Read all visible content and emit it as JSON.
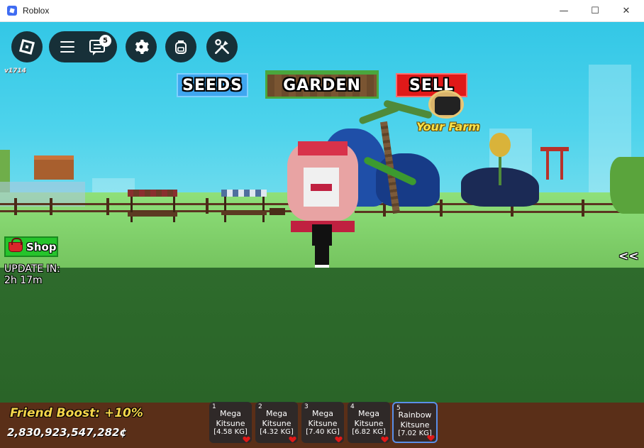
{
  "window": {
    "title": "Roblox",
    "minimize": "—",
    "maximize": "☐",
    "close": "✕"
  },
  "hud": {
    "chat_badge": "5",
    "version": "v1714"
  },
  "game_buttons": {
    "seeds": "SEEDS",
    "garden": "GARDEN",
    "sell": "SELL"
  },
  "farm": {
    "label": "Your Farm"
  },
  "shop": {
    "label": "Shop"
  },
  "update": {
    "label": "UPDATE IN:",
    "time": "2h 17m"
  },
  "side_toggle": "<<",
  "bottom": {
    "friend_boost": "Friend Boost: +10%",
    "money": "2,830,923,547,282¢"
  },
  "hotbar": [
    {
      "num": "1",
      "name": "Mega\nKitsune",
      "weight": "[4.58 KG]",
      "selected": false
    },
    {
      "num": "2",
      "name": "Mega\nKitsune",
      "weight": "[4.32 KG]",
      "selected": false
    },
    {
      "num": "3",
      "name": "Mega\nKitsune",
      "weight": "[7.40 KG]",
      "selected": false
    },
    {
      "num": "4",
      "name": "Mega\nKitsune",
      "weight": "[6.82 KG]",
      "selected": false
    },
    {
      "num": "5",
      "name": "Rainbow\nKitsune",
      "weight": "[7.02 KG]",
      "selected": true
    }
  ],
  "colors": {
    "sky": "#33c7e6",
    "grass": "#2e6b2c",
    "seeds": "#3fa6f0",
    "sell": "#e01919",
    "shop": "#25c42b",
    "friend_boost": "#f7d64a"
  }
}
